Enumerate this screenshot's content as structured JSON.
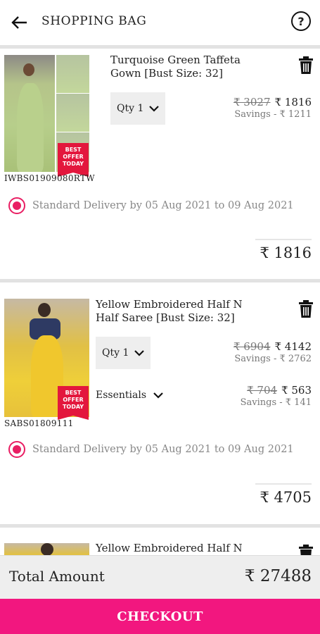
{
  "header": {
    "title": "SHOPPING BAG",
    "back_icon": "arrow-left-icon",
    "help_icon": "question-circle-icon",
    "help_glyph": "?"
  },
  "items": [
    {
      "title": "Turquoise Green Taffeta Gown [Bust Size: 32]",
      "sku": "IWBS01909080RTW",
      "badge": [
        "BEST",
        "OFFER",
        "TODAY"
      ],
      "qty_label": "Qty 1",
      "price_old": "₹ 3027",
      "price_new": "₹ 1816",
      "savings": "Savings - ₹ 1211",
      "delivery": "Standard Delivery by 05 Aug 2021 to 09 Aug 2021",
      "subtotal": "₹ 1816"
    },
    {
      "title": "Yellow Embroidered Half N Half Saree [Bust Size: 32]",
      "sku": "SABS01809111",
      "badge": [
        "BEST",
        "OFFER",
        "TODAY"
      ],
      "qty_label": "Qty 1",
      "price_old": "₹ 6904",
      "price_new": "₹ 4142",
      "savings": "Savings - ₹ 2762",
      "addon_label": "Essentials",
      "addon_price_old": "₹ 704",
      "addon_price_new": "₹ 563",
      "addon_savings": "Savings - ₹ 141",
      "delivery": "Standard Delivery by 05 Aug 2021 to 09 Aug 2021",
      "subtotal": "₹ 4705"
    },
    {
      "title": "Yellow Embroidered Half N"
    }
  ],
  "footer": {
    "total_label": "Total Amount",
    "total_value": "₹ 27488",
    "checkout_label": "CHECKOUT"
  },
  "colors": {
    "accent": "#f2177f",
    "radio": "#e91e63",
    "badge": "#e3173d"
  }
}
